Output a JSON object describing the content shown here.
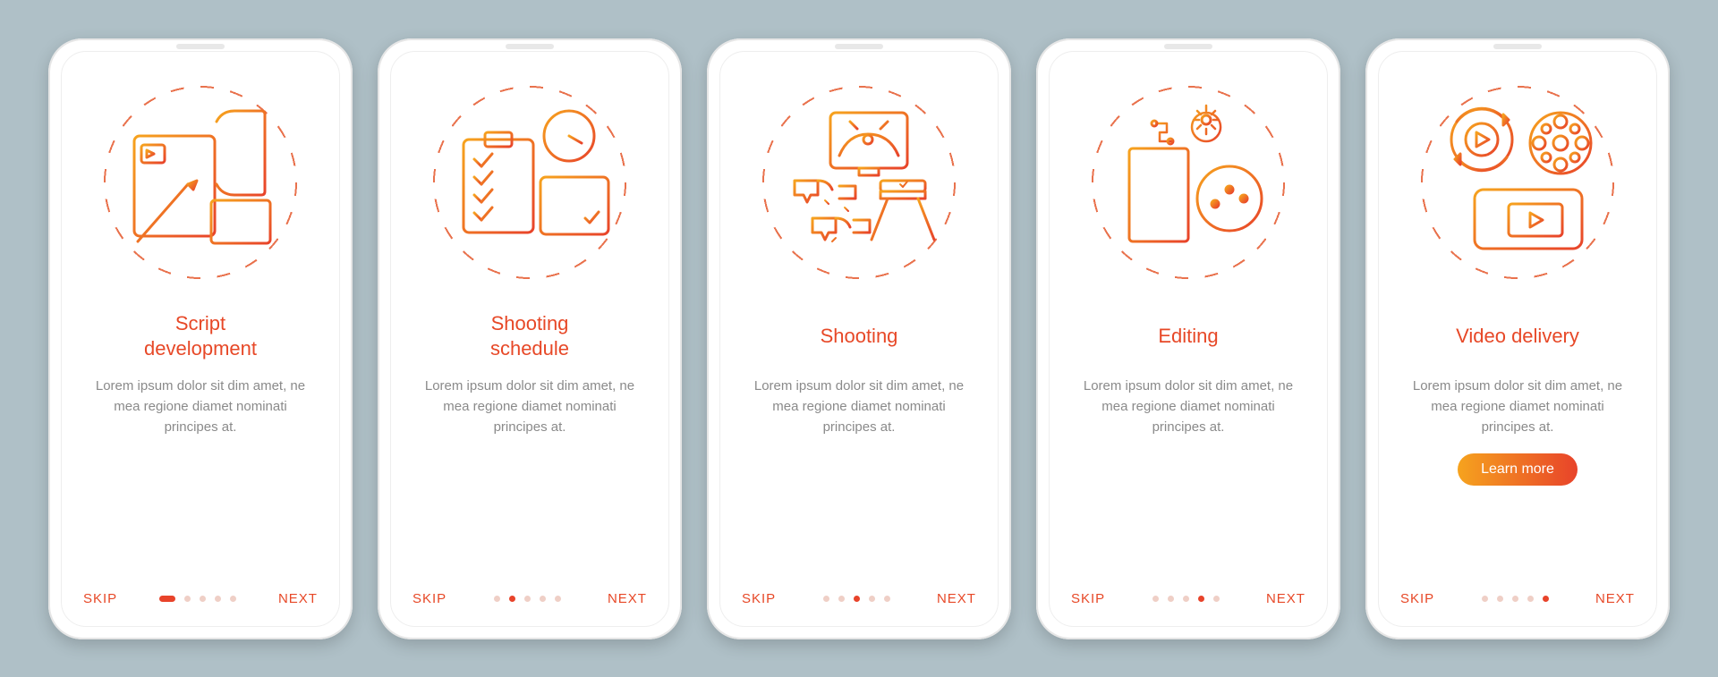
{
  "common": {
    "skip": "SKIP",
    "next": "NEXT",
    "description": "Lorem ipsum dolor sit dim amet, ne mea regione diamet nominati principes at.",
    "learn_more": "Learn more",
    "dot_count": 5
  },
  "screens": [
    {
      "title": "Script\ndevelopment",
      "active_dot": 0,
      "style": "bar",
      "icon": "script-development-icon",
      "has_cta": false
    },
    {
      "title": "Shooting\nschedule",
      "active_dot": 1,
      "style": "dot",
      "icon": "shooting-schedule-icon",
      "has_cta": false
    },
    {
      "title": "Shooting",
      "active_dot": 2,
      "style": "dot",
      "icon": "shooting-icon",
      "has_cta": false
    },
    {
      "title": "Editing",
      "active_dot": 3,
      "style": "dot",
      "icon": "editing-icon",
      "has_cta": false
    },
    {
      "title": "Video delivery",
      "active_dot": 4,
      "style": "dot",
      "icon": "video-delivery-icon",
      "has_cta": true
    }
  ]
}
